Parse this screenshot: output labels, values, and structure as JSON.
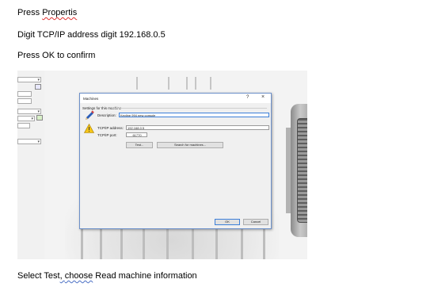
{
  "document": {
    "line1": {
      "prefix": "Press ",
      "word": "Propertis"
    },
    "line2": "Digit TCP/IP address digit 192.168.0.5",
    "line3": "Press OK to confirm",
    "line4": {
      "prefix": "Select Test",
      "mid": ", ",
      "word": "choose",
      "suffix": " Read machine information"
    }
  },
  "dialog": {
    "title": "Machines",
    "help_label": "?",
    "close_label": "×",
    "group_label": "Settings for this machine",
    "description_label": "Description:",
    "description_value": "Keyline 994 new console",
    "ip_label": "TCP/IP address:",
    "ip_value": "192.168.0.5",
    "port_label": "TCP/IP port:",
    "port_value": "61770",
    "test_button": "Test...",
    "search_button": "Search for machines...",
    "ok_button": "OK",
    "cancel_button": "Cancel"
  }
}
